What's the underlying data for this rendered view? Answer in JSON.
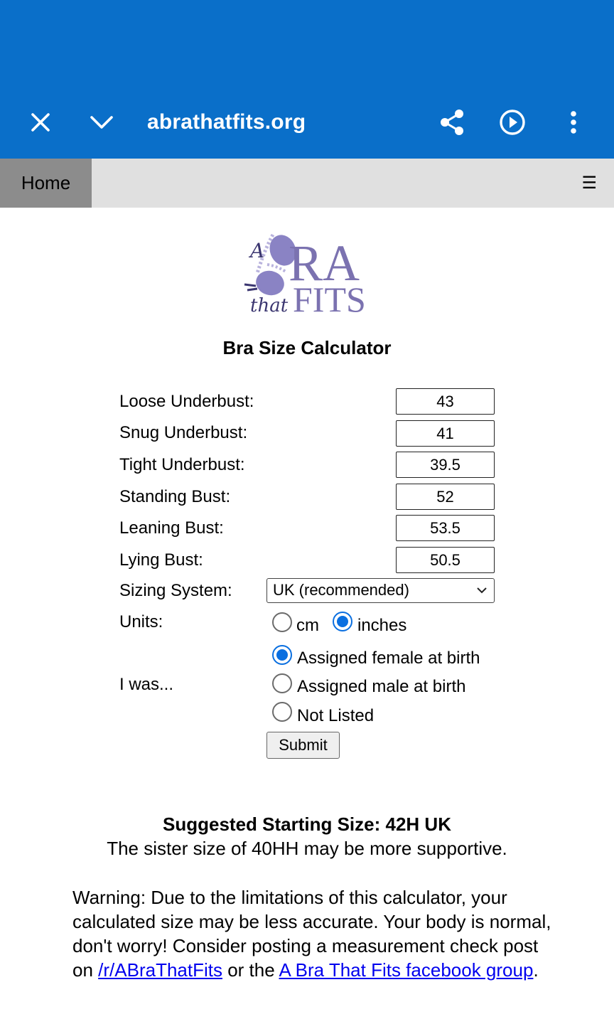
{
  "browser": {
    "url": "abrathatfits.org",
    "close_icon": "close-icon",
    "collapse_icon": "chevron-down-icon",
    "share_icon": "share-icon",
    "play_icon": "play-circle-icon",
    "menu_icon": "more-vert-icon",
    "bar_color": "#0a6fc9"
  },
  "nav": {
    "home_label": "Home",
    "menu_glyph": "☰"
  },
  "logo": {
    "text_a": "A",
    "text_ra": "RA",
    "text_that": "that",
    "text_fits": "FITS",
    "color": "#7b72b0"
  },
  "calculator": {
    "title": "Bra Size Calculator",
    "fields": [
      {
        "label": "Loose Underbust:",
        "value": "43"
      },
      {
        "label": "Snug Underbust:",
        "value": "41"
      },
      {
        "label": "Tight Underbust:",
        "value": "39.5"
      },
      {
        "label": "Standing Bust:",
        "value": "52"
      },
      {
        "label": "Leaning Bust:",
        "value": "53.5"
      },
      {
        "label": "Lying Bust:",
        "value": "50.5"
      }
    ],
    "sizing_label": "Sizing System:",
    "sizing_value": "UK (recommended)",
    "units_label": "Units:",
    "units_options": [
      "cm",
      "inches"
    ],
    "units_selected": "inches",
    "gender_label": "I was...",
    "gender_options": [
      "Assigned female at birth",
      "Assigned male at birth",
      "Not Listed"
    ],
    "gender_selected": "Assigned female at birth",
    "submit_label": "Submit"
  },
  "result": {
    "title": "Suggested Starting Size: 42H UK",
    "sister": "The sister size of 40HH may be more supportive."
  },
  "warning": {
    "text1": "Warning: Due to the limitations of this calculator, your calculated size may be less accurate. Your body is normal, don't worry! Consider posting a measurement check post on ",
    "link1": "/r/ABraThatFits",
    "text2": " or the ",
    "link2": "A Bra That Fits facebook group",
    "text3": "."
  }
}
